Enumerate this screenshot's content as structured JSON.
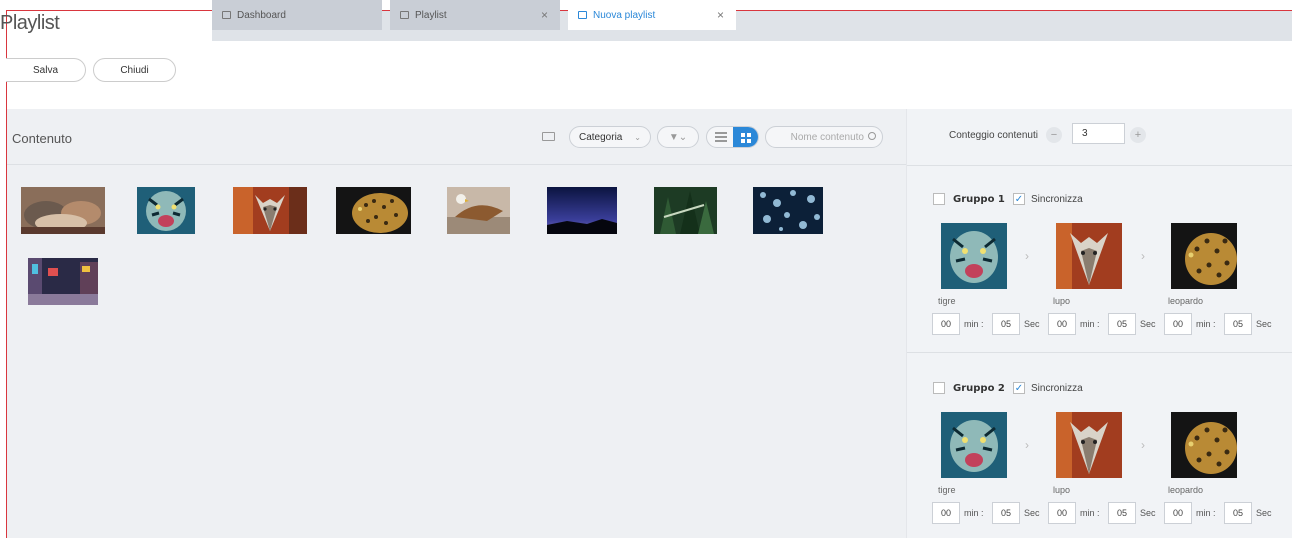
{
  "app": {
    "title": "Playlist"
  },
  "tabs": [
    {
      "label": "Dashboard"
    },
    {
      "label": "Playlist",
      "close": "×"
    },
    {
      "label": "Nuova playlist",
      "close": "×",
      "active": true
    }
  ],
  "toolbar": {
    "save_label": "Salva",
    "close_label": "Chiudi"
  },
  "content": {
    "title": "Contenuto",
    "category_label": "Categoria",
    "category_chevron": "⌄",
    "filter_label": "▼⌄",
    "search_placeholder": "Nome contenuto",
    "icons": [
      "folder-icon",
      "filter-icon",
      "list-view-icon",
      "grid-view-icon",
      "search-icon"
    ]
  },
  "count": {
    "label": "Conteggio contenuti",
    "value": "3",
    "minus": "−",
    "plus": "+"
  },
  "groups": [
    {
      "name": "Gruppo 1",
      "sync_label": "Sincronizza",
      "sync_checked": true,
      "items": [
        {
          "caption": "tigre",
          "min": "00",
          "min_label": "min :",
          "sec": "05",
          "sec_label": "Sec"
        },
        {
          "caption": "lupo",
          "min": "00",
          "min_label": "min :",
          "sec": "05",
          "sec_label": "Sec"
        },
        {
          "caption": "leopardo",
          "min": "00",
          "min_label": "min :",
          "sec": "05",
          "sec_label": "Sec"
        }
      ]
    },
    {
      "name": "Gruppo 2",
      "sync_label": "Sincronizza",
      "sync_checked": true,
      "items": [
        {
          "caption": "tigre",
          "min": "00",
          "min_label": "min :",
          "sec": "05",
          "sec_label": "Sec"
        },
        {
          "caption": "lupo",
          "min": "00",
          "min_label": "min :",
          "sec": "05",
          "sec_label": "Sec"
        },
        {
          "caption": "leopardo",
          "min": "00",
          "min_label": "min :",
          "sec": "05",
          "sec_label": "Sec"
        }
      ]
    }
  ],
  "colors": {
    "accent": "#2b88d8",
    "panel": "#eef0f3",
    "border": "#d9363e"
  }
}
